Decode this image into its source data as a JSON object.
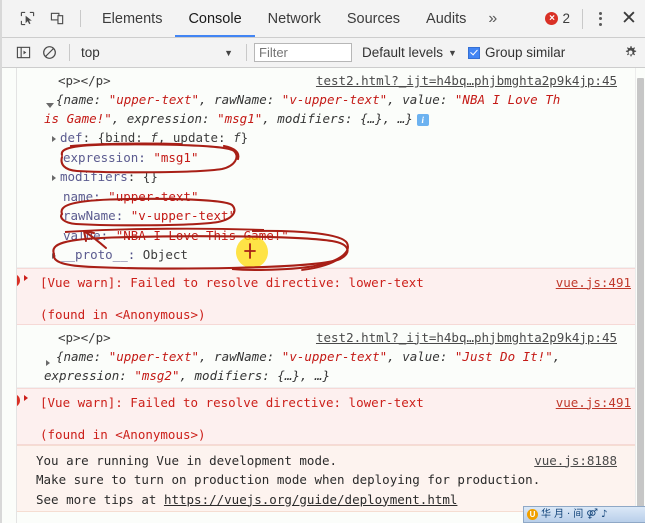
{
  "devtools": {
    "tabbar": {
      "inspect_icon": "inspect-cursor-icon",
      "device_icon": "device-toolbar-icon",
      "tabs": [
        {
          "label": "Elements",
          "active": false
        },
        {
          "label": "Console",
          "active": true
        },
        {
          "label": "Network",
          "active": false
        },
        {
          "label": "Sources",
          "active": false
        },
        {
          "label": "Audits",
          "active": false
        }
      ],
      "more_label": "»",
      "error_count": "2",
      "error_dot_glyph": "×",
      "close_label": "✕",
      "error_color": "#d93025",
      "accent_color": "#4285f4"
    },
    "filterbar": {
      "sidebar_icon": "console-sidebar-icon",
      "clear_icon": "clear-console-icon",
      "context": "top",
      "context_caret": "▼",
      "filter_value": "",
      "filter_placeholder": "Filter",
      "levels_label": "Default levels",
      "levels_caret": "▼",
      "group_similar_label": "Group similar",
      "group_similar_checked": true,
      "settings_icon": "gear-icon"
    },
    "console": {
      "entries": [
        {
          "type": "log",
          "tag": "<p></p>",
          "source": "test2.html?_ijt=h4bq…phjbmghta2p9k4jp:45",
          "preview_line1_a": "{name: ",
          "preview_line1_s1": "\"upper-text\"",
          "preview_line1_b": ", rawName: ",
          "preview_line1_s2": "\"v-upper-text\"",
          "preview_line1_c": ", value: ",
          "preview_line1_s3": "\"NBA I Love Th",
          "preview_line2_s3b": "is Game!\"",
          "preview_line2_a": ", expression: ",
          "preview_line2_s4": "\"msg1\"",
          "preview_line2_b": ", modifiers: {…}, …}",
          "info_badge": "i",
          "expanded": true,
          "props": [
            {
              "name": "def",
              "value": "{bind: f, update: f}",
              "kind": "obj",
              "expandable": true,
              "circled": false
            },
            {
              "name": "expression",
              "value": "\"msg1\"",
              "kind": "str",
              "expandable": false,
              "circled": true
            },
            {
              "name": "modifiers",
              "value": "{}",
              "kind": "obj",
              "expandable": true,
              "circled": false
            },
            {
              "name": "name",
              "value": "\"upper-text\"",
              "kind": "str",
              "expandable": false,
              "circled": true
            },
            {
              "name": "rawName",
              "value": "\"v-upper-text\"",
              "kind": "str",
              "expandable": false,
              "circled": false
            },
            {
              "name": "value",
              "value": "\"NBA I Love This Game!\"",
              "kind": "str",
              "expandable": false,
              "circled": true
            },
            {
              "name": "__proto__",
              "value": "Object",
              "kind": "obj",
              "expandable": true,
              "circled": false
            }
          ]
        },
        {
          "type": "error",
          "text": "[Vue warn]: Failed to resolve directive: lower-text",
          "sub": "(found in <Anonymous>)",
          "source": "vue.js:491"
        },
        {
          "type": "log",
          "tag": "<p></p>",
          "source": "test2.html?_ijt=h4bq…phjbmghta2p9k4jp:45",
          "preview_line1_a": "{name: ",
          "preview_line1_s1": "\"upper-text\"",
          "preview_line1_b": ", rawName: ",
          "preview_line1_s2": "\"v-upper-text\"",
          "preview_line1_c": ", value: ",
          "preview_line1_s3": "\"Just Do It!\"",
          "preview_line1_d": ",",
          "preview_line2_a": "expression: ",
          "preview_line2_s4": "\"msg2\"",
          "preview_line2_b": ", modifiers: {…}, …}",
          "expanded": false
        },
        {
          "type": "error",
          "text": "[Vue warn]: Failed to resolve directive: lower-text",
          "sub": "(found in <Anonymous>)",
          "source": "vue.js:491"
        },
        {
          "type": "warn",
          "line1": "You are running Vue in development mode.",
          "line2": "Make sure to turn on production mode when deploying for production.",
          "line3_pre": "See more tips at ",
          "line3_link": "https://vuejs.org/guide/deployment.html",
          "source": "vue.js:8188"
        }
      ]
    },
    "annotations": {
      "ink_color": "#a81f16",
      "highlight_color": "#ffd800",
      "circled_labels": [
        "expression: \"msg1\"",
        "name: \"upper-text\"",
        "value: \"NBA I Love This Game!\""
      ],
      "arrow_note": "arrow from value row pointing up-left to rawName row",
      "cursor_highlight_over": "This"
    },
    "ime": {
      "items": [
        "①",
        "华",
        "月",
        "·",
        "间",
        "⚤",
        "♪"
      ]
    }
  }
}
